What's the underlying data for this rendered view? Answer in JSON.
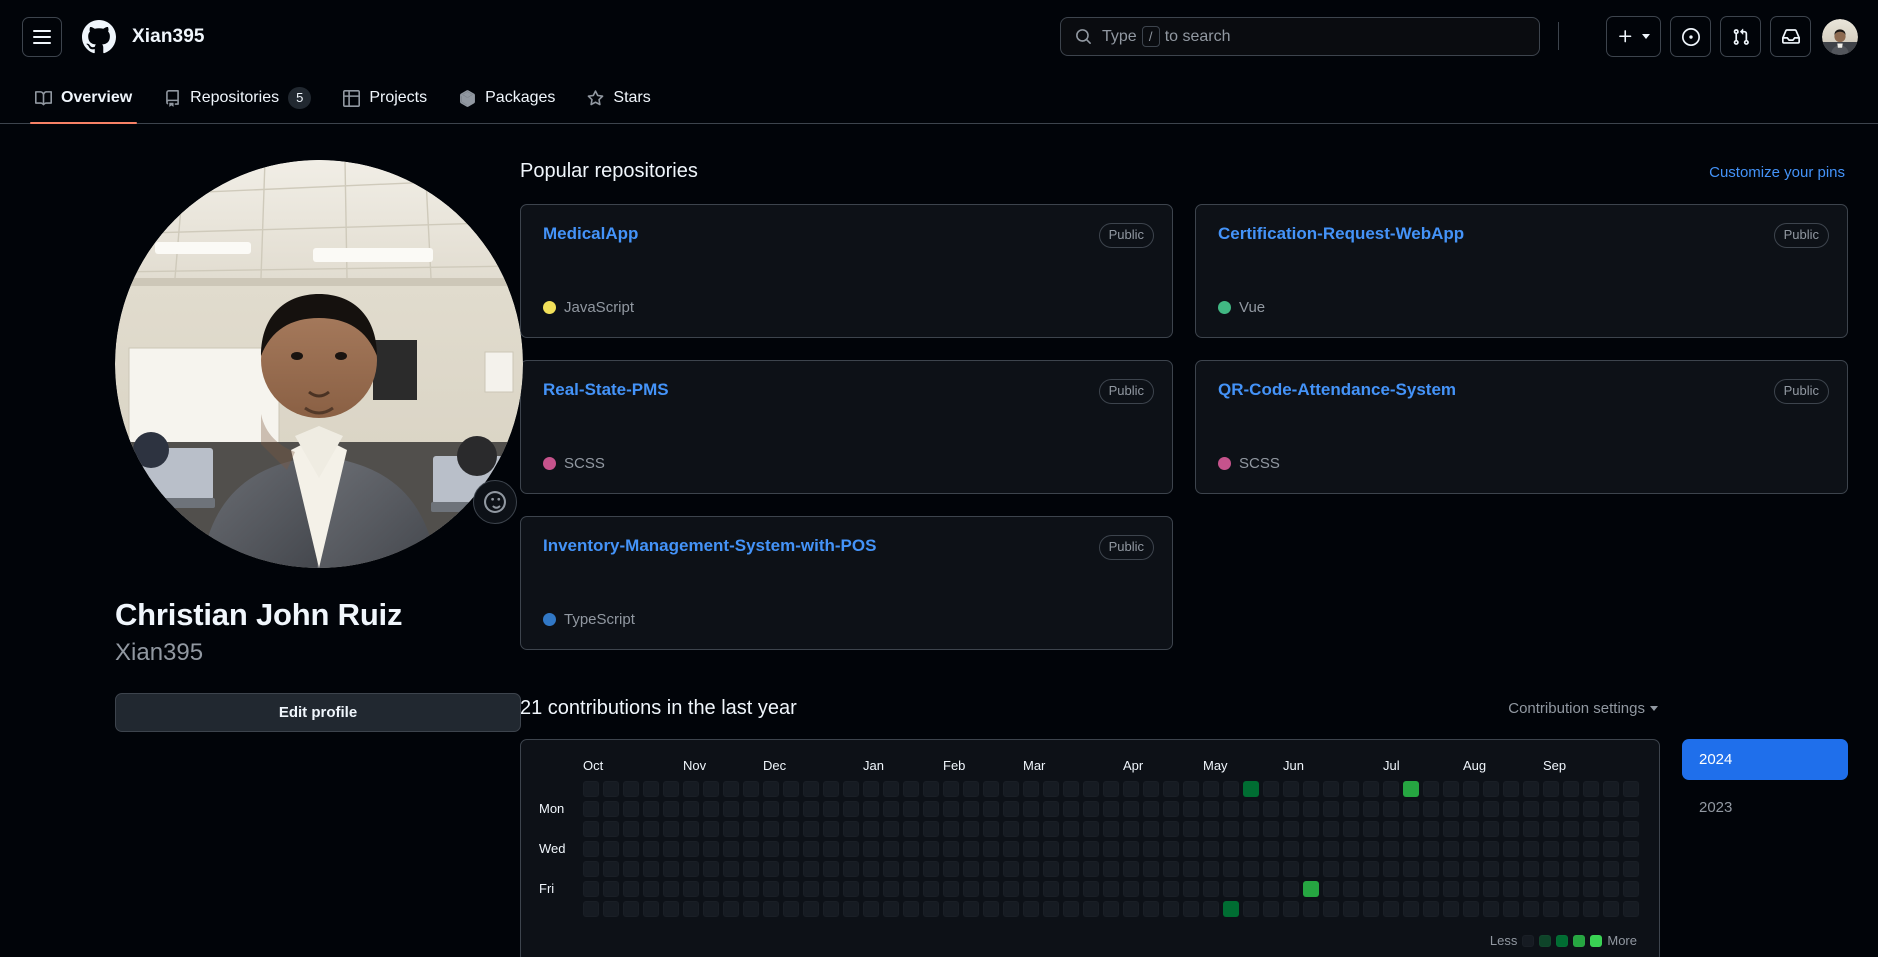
{
  "header": {
    "menu_label": "Open menu",
    "logo_label": "GitHub",
    "owner": "Xian395",
    "search": {
      "prefix": "Type",
      "key": "/",
      "suffix": "to search",
      "placeholder": "Type / to search"
    },
    "actions": [
      {
        "name": "create-new-button",
        "icon": "plus-icon",
        "label": "Create new..."
      },
      {
        "name": "issues-button",
        "icon": "issue-opened-icon",
        "label": "Issues"
      },
      {
        "name": "pull-requests-button",
        "icon": "git-pull-request-icon",
        "label": "Pull requests"
      },
      {
        "name": "notifications-button",
        "icon": "inbox-icon",
        "label": "Notifications"
      }
    ],
    "avatar_label": "Xian395"
  },
  "nav": {
    "tabs": [
      {
        "label": "Overview",
        "icon": "book-icon",
        "active": true,
        "count": null
      },
      {
        "label": "Repositories",
        "icon": "repo-icon",
        "active": false,
        "count": "5"
      },
      {
        "label": "Projects",
        "icon": "table-icon",
        "active": false,
        "count": null
      },
      {
        "label": "Packages",
        "icon": "package-icon",
        "active": false,
        "count": null
      },
      {
        "label": "Stars",
        "icon": "star-icon",
        "active": false,
        "count": null
      }
    ]
  },
  "profile": {
    "avatar_alt": "Christian John Ruiz",
    "emoji_status_icon": "smiley-icon",
    "name": "Christian John Ruiz",
    "login": "Xian395",
    "edit_button": "Edit profile"
  },
  "popular": {
    "title": "Popular repositories",
    "customize_link": "Customize your pins",
    "repos": [
      {
        "name": "MedicalApp",
        "visibility": "Public",
        "language": "JavaScript",
        "color": "#f1e05a"
      },
      {
        "name": "Certification-Request-WebApp",
        "visibility": "Public",
        "language": "Vue",
        "color": "#41b883"
      },
      {
        "name": "Real-State-PMS",
        "visibility": "Public",
        "language": "SCSS",
        "color": "#c6538c"
      },
      {
        "name": "QR-Code-Attendance-System",
        "visibility": "Public",
        "language": "SCSS",
        "color": "#c6538c"
      },
      {
        "name": "Inventory-Management-System-with-POS",
        "visibility": "Public",
        "language": "TypeScript",
        "color": "#3178c6"
      }
    ]
  },
  "contributions": {
    "title": "21 contributions in the last year",
    "settings_label": "Contribution settings",
    "months": [
      "Oct",
      "Nov",
      "Dec",
      "Jan",
      "Feb",
      "Mar",
      "Apr",
      "May",
      "Jun",
      "Jul",
      "Aug",
      "Sep"
    ],
    "month_week_index": [
      0,
      5,
      9,
      14,
      18,
      22,
      27,
      31,
      35,
      40,
      44,
      48
    ],
    "day_labels": [
      "",
      "Mon",
      "",
      "Wed",
      "",
      "Fri",
      ""
    ],
    "weeks": 53,
    "legend_less": "Less",
    "legend_more": "More",
    "level_colors": [
      "#161b22",
      "#0e4429",
      "#006d32",
      "#26a641",
      "#39d353"
    ],
    "cells": [
      {
        "week": 33,
        "day": 0,
        "level": 2
      },
      {
        "week": 41,
        "day": 0,
        "level": 3
      },
      {
        "week": 36,
        "day": 5,
        "level": 3
      },
      {
        "week": 32,
        "day": 6,
        "level": 2
      },
      {
        "week": 31,
        "day": 7,
        "level": 2
      }
    ],
    "years": [
      {
        "label": "2024",
        "selected": true
      },
      {
        "label": "2023",
        "selected": false
      }
    ]
  },
  "colors": {
    "accent": "#1f6feb",
    "link": "#4493f8",
    "tab_underline": "#f78166",
    "card_bg": "#0d1117",
    "page_bg": "#010409",
    "border": "#3d444d",
    "muted": "#9198a1"
  }
}
